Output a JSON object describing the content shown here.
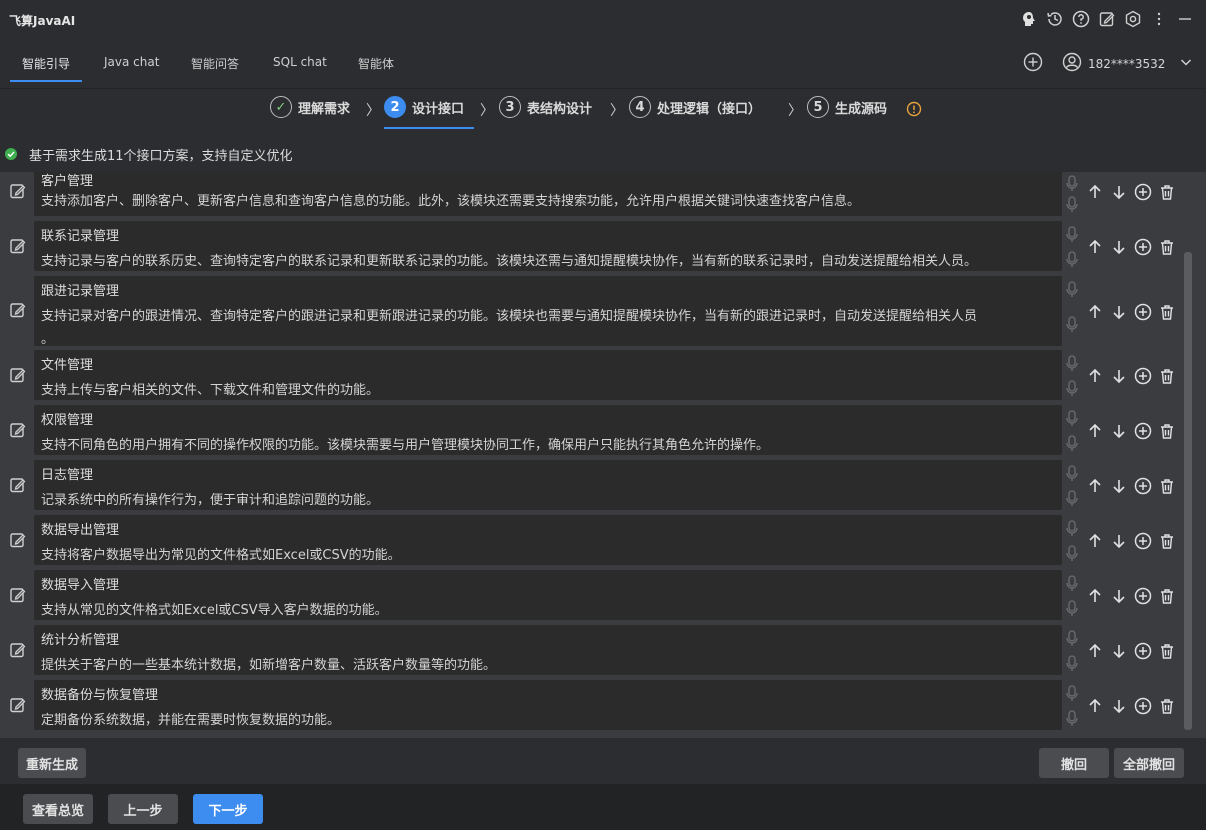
{
  "app": {
    "title": "飞算JavaAI"
  },
  "tabs": [
    {
      "label": "智能引导"
    },
    {
      "label": "Java chat"
    },
    {
      "label": "智能问答"
    },
    {
      "label": "SQL chat"
    },
    {
      "label": "智能体"
    }
  ],
  "user": {
    "account": "182****3532"
  },
  "steps": [
    {
      "num": "✓",
      "label": "理解需求"
    },
    {
      "num": "2",
      "label": "设计接口"
    },
    {
      "num": "3",
      "label": "表结构设计"
    },
    {
      "num": "4",
      "label": "处理逻辑（接口）"
    },
    {
      "num": "5",
      "label": "生成源码"
    }
  ],
  "status": {
    "text": "基于需求生成11个接口方案，支持自定义优化"
  },
  "items": [
    {
      "name": "客户管理",
      "desc": "支持添加客户、删除客户、更新客户信息和查询客户信息的功能。此外，该模块还需要支持搜索功能，允许用户根据关键词快速查找客户信息。",
      "desc2": ""
    },
    {
      "name": "联系记录管理",
      "desc": "支持记录与客户的联系历史、查询特定客户的联系记录和更新联系记录的功能。该模块还需与通知提醒模块协作，当有新的联系记录时，自动发送提醒给相关人员。",
      "desc2": ""
    },
    {
      "name": "跟进记录管理",
      "desc": "支持记录对客户的跟进情况、查询特定客户的跟进记录和更新跟进记录的功能。该模块也需要与通知提醒模块协作，当有新的跟进记录时，自动发送提醒给相关人员",
      "desc2": "。"
    },
    {
      "name": "文件管理",
      "desc": "支持上传与客户相关的文件、下载文件和管理文件的功能。",
      "desc2": ""
    },
    {
      "name": "权限管理",
      "desc": "支持不同角色的用户拥有不同的操作权限的功能。该模块需要与用户管理模块协同工作，确保用户只能执行其角色允许的操作。",
      "desc2": ""
    },
    {
      "name": "日志管理",
      "desc": "记录系统中的所有操作行为，便于审计和追踪问题的功能。",
      "desc2": ""
    },
    {
      "name": "数据导出管理",
      "desc": "支持将客户数据导出为常见的文件格式如Excel或CSV的功能。",
      "desc2": ""
    },
    {
      "name": "数据导入管理",
      "desc": "支持从常见的文件格式如Excel或CSV导入客户数据的功能。",
      "desc2": ""
    },
    {
      "name": "统计分析管理",
      "desc": "提供关于客户的一些基本统计数据，如新增客户数量、活跃客户数量等的功能。",
      "desc2": ""
    },
    {
      "name": "数据备份与恢复管理",
      "desc": "定期备份系统数据，并能在需要时恢复数据的功能。",
      "desc2": ""
    }
  ],
  "buttons": {
    "regenerate": "重新生成",
    "undo": "撤回",
    "undo_all": "全部撤回",
    "overview": "查看总览",
    "prev": "上一步",
    "next": "下一步"
  },
  "icons": {
    "title_bar": [
      "brain-icon",
      "history-icon",
      "help-icon",
      "edit-icon",
      "settings-icon",
      "more-icon",
      "minimize-icon"
    ],
    "row_actions": [
      "arrow-up-icon",
      "arrow-down-icon",
      "add-circle-icon",
      "trash-icon"
    ]
  },
  "colors": {
    "accent": "#3d8cf0",
    "success": "#3fae4f",
    "warning": "#e6a23c"
  }
}
